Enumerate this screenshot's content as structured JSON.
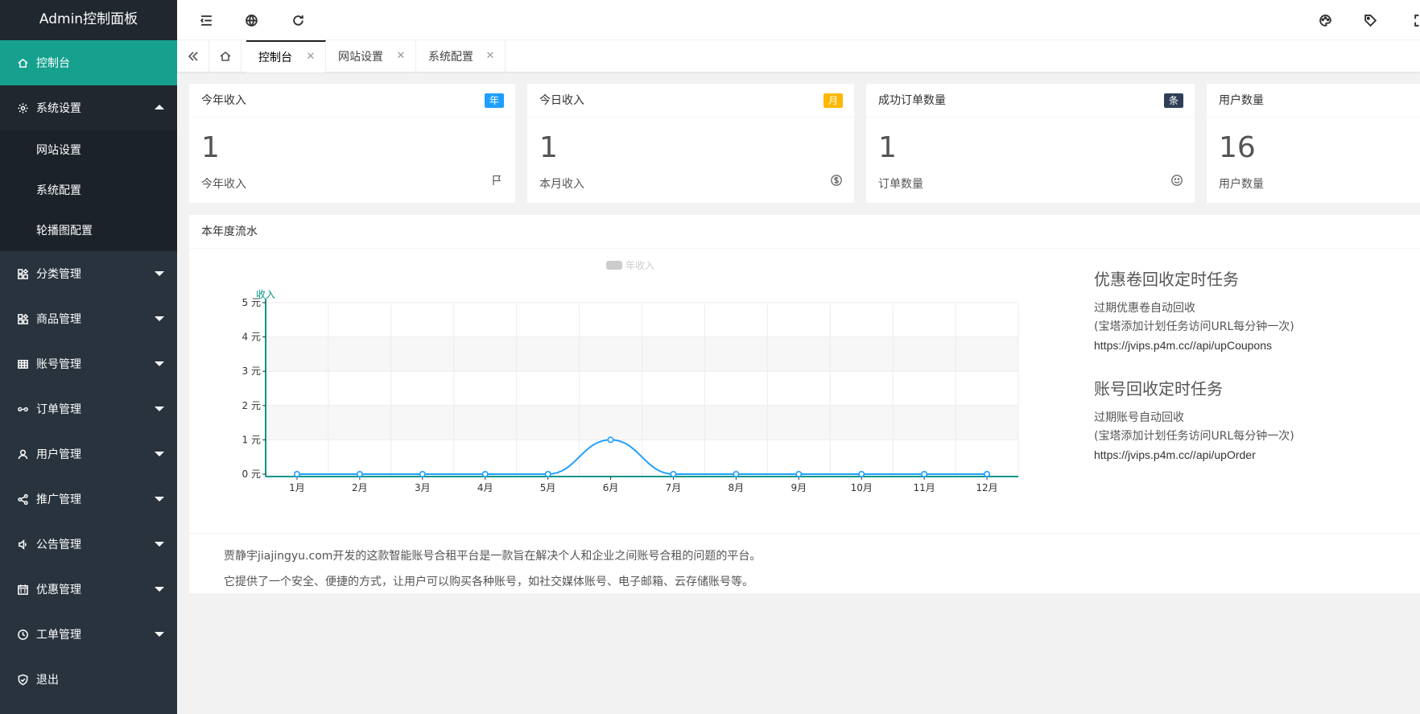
{
  "app": {
    "title": "Admin控制面板"
  },
  "sidebar": {
    "items": [
      {
        "label": "控制台",
        "icon": "home-icon",
        "active": true
      },
      {
        "label": "系统设置",
        "icon": "gear-icon",
        "open": true,
        "children": [
          {
            "label": "网站设置"
          },
          {
            "label": "系统配置"
          },
          {
            "label": "轮播图配置"
          }
        ]
      },
      {
        "label": "分类管理",
        "icon": "apps-icon"
      },
      {
        "label": "商品管理",
        "icon": "apps-icon"
      },
      {
        "label": "账号管理",
        "icon": "grid-icon"
      },
      {
        "label": "订单管理",
        "icon": "link-icon"
      },
      {
        "label": "用户管理",
        "icon": "user-icon"
      },
      {
        "label": "推广管理",
        "icon": "share-icon"
      },
      {
        "label": "公告管理",
        "icon": "speaker-icon"
      },
      {
        "label": "优惠管理",
        "icon": "calendar-icon"
      },
      {
        "label": "工单管理",
        "icon": "clock-icon"
      },
      {
        "label": "退出",
        "icon": "shield-icon"
      }
    ]
  },
  "header": {
    "left_icons": [
      "menu-shrink-icon",
      "globe-icon",
      "refresh-icon"
    ],
    "right_icons": [
      "palette-icon",
      "tag-icon",
      "fullscreen-icon"
    ]
  },
  "tabs": {
    "items": [
      {
        "label": "控制台",
        "active": true
      },
      {
        "label": "网站设置"
      },
      {
        "label": "系统配置"
      }
    ],
    "close_glyph": "✕"
  },
  "stats": [
    {
      "title": "今年收入",
      "badge": "年",
      "badge_color": "#1e9fff",
      "value": "1",
      "label": "今年收入",
      "icon": "flag-icon"
    },
    {
      "title": "今日收入",
      "badge": "月",
      "badge_color": "#ffb800",
      "value": "1",
      "label": "本月收入",
      "icon": "dollar-icon"
    },
    {
      "title": "成功订单数量",
      "badge": "条",
      "badge_color": "#2f4056",
      "value": "1",
      "label": "订单数量",
      "icon": "smile-icon"
    },
    {
      "title": "用户数量",
      "badge": "",
      "value": "16",
      "label": "用户数量",
      "icon": ""
    }
  ],
  "chart_panel": {
    "title": "本年度流水",
    "footer_lines": [
      "贾静宇jiajingyu.com开发的这款智能账号合租平台是一款旨在解决个人和企业之间账号合租的问题的平台。",
      "它提供了一个安全、便捷的方式，让用户可以购买各种账号，如社交媒体账号、电子邮箱、云存储账号等。"
    ]
  },
  "tasks": [
    {
      "title": "优惠卷回收定时任务",
      "desc": "过期优惠卷自动回收",
      "note": "(宝塔添加计划任务访问URL每分钟一次)",
      "url": "https://jvips.p4m.cc//api/upCoupons"
    },
    {
      "title": "账号回收定时任务",
      "desc": "过期账号自动回收",
      "note": "(宝塔添加计划任务访问URL每分钟一次)",
      "url": "https://jvips.p4m.cc//api/upOrder"
    }
  ],
  "chart_data": {
    "type": "line",
    "categories": [
      "1月",
      "2月",
      "3月",
      "4月",
      "5月",
      "6月",
      "7月",
      "8月",
      "9月",
      "10月",
      "11月",
      "12月"
    ],
    "series": [
      {
        "name": "年收入",
        "values": [
          0,
          0,
          0,
          0,
          0,
          1,
          0,
          0,
          0,
          0,
          0,
          0
        ]
      }
    ],
    "ylabel": "收入",
    "yticks": [
      "0 元",
      "1 元",
      "2 元",
      "3 元",
      "4 元",
      "5 元"
    ],
    "ylim": [
      0,
      5
    ],
    "smooth": true,
    "grid": true,
    "legend": "top-center",
    "colors": {
      "line": "#1e9fff",
      "axis": "#009688",
      "legend_swatch": "#cccccc",
      "legend_text": "#cccccc"
    }
  }
}
